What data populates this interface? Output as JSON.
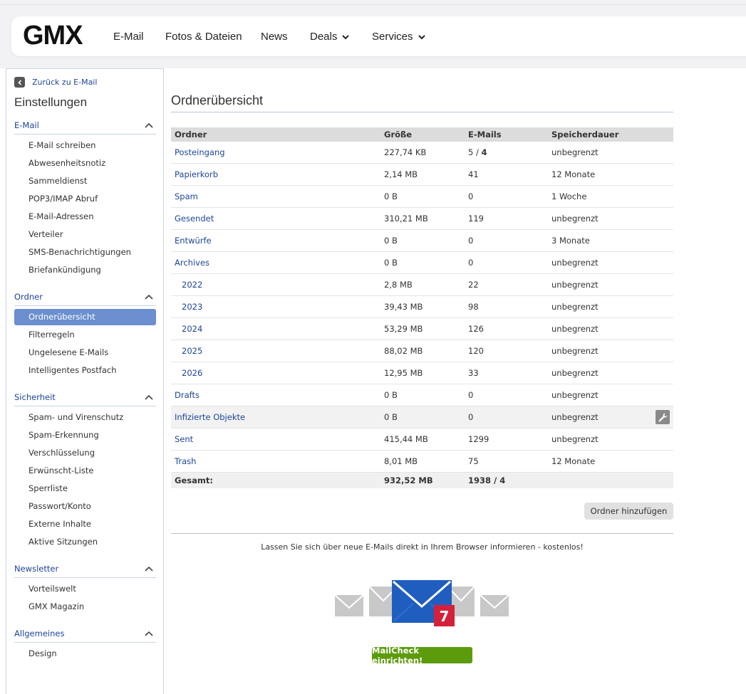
{
  "brand": {
    "logo": "GMX"
  },
  "nav": {
    "items": [
      {
        "label": "E-Mail"
      },
      {
        "label": "Fotos & Dateien"
      },
      {
        "label": "News"
      },
      {
        "label": "Deals"
      },
      {
        "label": "Services"
      }
    ]
  },
  "sidebar": {
    "back_label": "Zurück zu E-Mail",
    "title": "Einstellungen",
    "sections": [
      {
        "label": "E-Mail",
        "items": [
          "E-Mail schreiben",
          "Abwesenheitsnotiz",
          "Sammeldienst",
          "POP3/IMAP Abruf",
          "E-Mail-Adressen",
          "Verteiler",
          "SMS-Benachrichtigungen",
          "Briefankündigung"
        ]
      },
      {
        "label": "Ordner",
        "items": [
          "Ordnerübersicht",
          "Filterregeln",
          "Ungelesene E-Mails",
          "Intelligentes Postfach"
        ]
      },
      {
        "label": "Sicherheit",
        "items": [
          "Spam- und Virenschutz",
          "Spam-Erkennung",
          "Verschlüsselung",
          "Erwünscht-Liste",
          "Sperrliste",
          "Passwort/Konto",
          "Externe Inhalte",
          "Aktive Sitzungen"
        ]
      },
      {
        "label": "Newsletter",
        "items": [
          "Vorteilswelt",
          "GMX Magazin"
        ]
      },
      {
        "label": "Allgemeines",
        "items": [
          "Design"
        ]
      }
    ],
    "active_item": "Ordnerübersicht"
  },
  "main": {
    "title": "Ordnerübersicht",
    "table": {
      "headers": [
        "Ordner",
        "Größe",
        "E-Mails",
        "Speicherdauer"
      ],
      "rows": [
        {
          "name": "Posteingang",
          "size": "227,74 KB",
          "emails": "5 / ",
          "emails_bold": "4",
          "storage": "unbegrenzt"
        },
        {
          "name": "Papierkorb",
          "size": "2,14 MB",
          "emails": "41",
          "storage": "12 Monate"
        },
        {
          "name": "Spam",
          "size": "0 B",
          "emails": "0",
          "storage": "1 Woche"
        },
        {
          "name": "Gesendet",
          "size": "310,21 MB",
          "emails": "119",
          "storage": "unbegrenzt"
        },
        {
          "name": "Entwürfe",
          "size": "0 B",
          "emails": "0",
          "storage": "3 Monate"
        },
        {
          "name": "Archives",
          "size": "0 B",
          "emails": "0",
          "storage": "unbegrenzt"
        },
        {
          "name": "2022",
          "size": "2,8 MB",
          "emails": "22",
          "storage": "unbegrenzt",
          "sub": true
        },
        {
          "name": "2023",
          "size": "39,43 MB",
          "emails": "98",
          "storage": "unbegrenzt",
          "sub": true
        },
        {
          "name": "2024",
          "size": "53,29 MB",
          "emails": "126",
          "storage": "unbegrenzt",
          "sub": true
        },
        {
          "name": "2025",
          "size": "88,02 MB",
          "emails": "120",
          "storage": "unbegrenzt",
          "sub": true
        },
        {
          "name": "2026",
          "size": "12,95 MB",
          "emails": "33",
          "storage": "unbegrenzt",
          "sub": true
        },
        {
          "name": "Drafts",
          "size": "0 B",
          "emails": "0",
          "storage": "unbegrenzt"
        },
        {
          "name": "Infizierte Objekte",
          "size": "0 B",
          "emails": "0",
          "storage": "unbegrenzt",
          "highlight": true,
          "wrench": true
        },
        {
          "name": "Sent",
          "size": "415,44 MB",
          "emails": "1299",
          "storage": "unbegrenzt"
        },
        {
          "name": "Trash",
          "size": "8,01 MB",
          "emails": "75",
          "storage": "12 Monate"
        }
      ],
      "footer": {
        "label": "Gesamt:",
        "size": "932,52 MB",
        "emails": "1938 / 4"
      }
    },
    "add_folder_label": "Ordner hinzufügen",
    "promo_text": "Lassen Sie sich über neue E-Mails direkt in Ihrem Browser informieren - kostenlos!",
    "badge_count": "7",
    "mailcheck_label": "MailCheck einrichten!"
  },
  "colors": {
    "link": "#1c449b",
    "active": "#6b8fcf",
    "mailcheck": "#5c9b0c",
    "badge": "#d3213c",
    "envelope": "#1f5ebf"
  }
}
